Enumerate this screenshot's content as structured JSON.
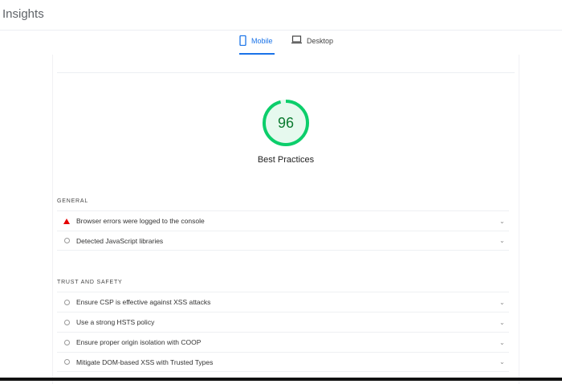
{
  "header": {
    "title": "Insights"
  },
  "tabs": [
    {
      "label": "Mobile",
      "icon": "phone-icon",
      "active": true
    },
    {
      "label": "Desktop",
      "icon": "laptop-icon",
      "active": false
    }
  ],
  "score": {
    "value": "96",
    "label": "Best Practices",
    "color": "#0cce6b"
  },
  "sections": [
    {
      "title": "GENERAL",
      "items": [
        {
          "label": "Browser errors were logged to the console",
          "status": "fail"
        },
        {
          "label": "Detected JavaScript libraries",
          "status": "info"
        }
      ]
    },
    {
      "title": "TRUST AND SAFETY",
      "items": [
        {
          "label": "Ensure CSP is effective against XSS attacks",
          "status": "info"
        },
        {
          "label": "Use a strong HSTS policy",
          "status": "info"
        },
        {
          "label": "Ensure proper origin isolation with COOP",
          "status": "info"
        },
        {
          "label": "Mitigate DOM-based XSS with Trusted Types",
          "status": "info"
        }
      ]
    }
  ]
}
